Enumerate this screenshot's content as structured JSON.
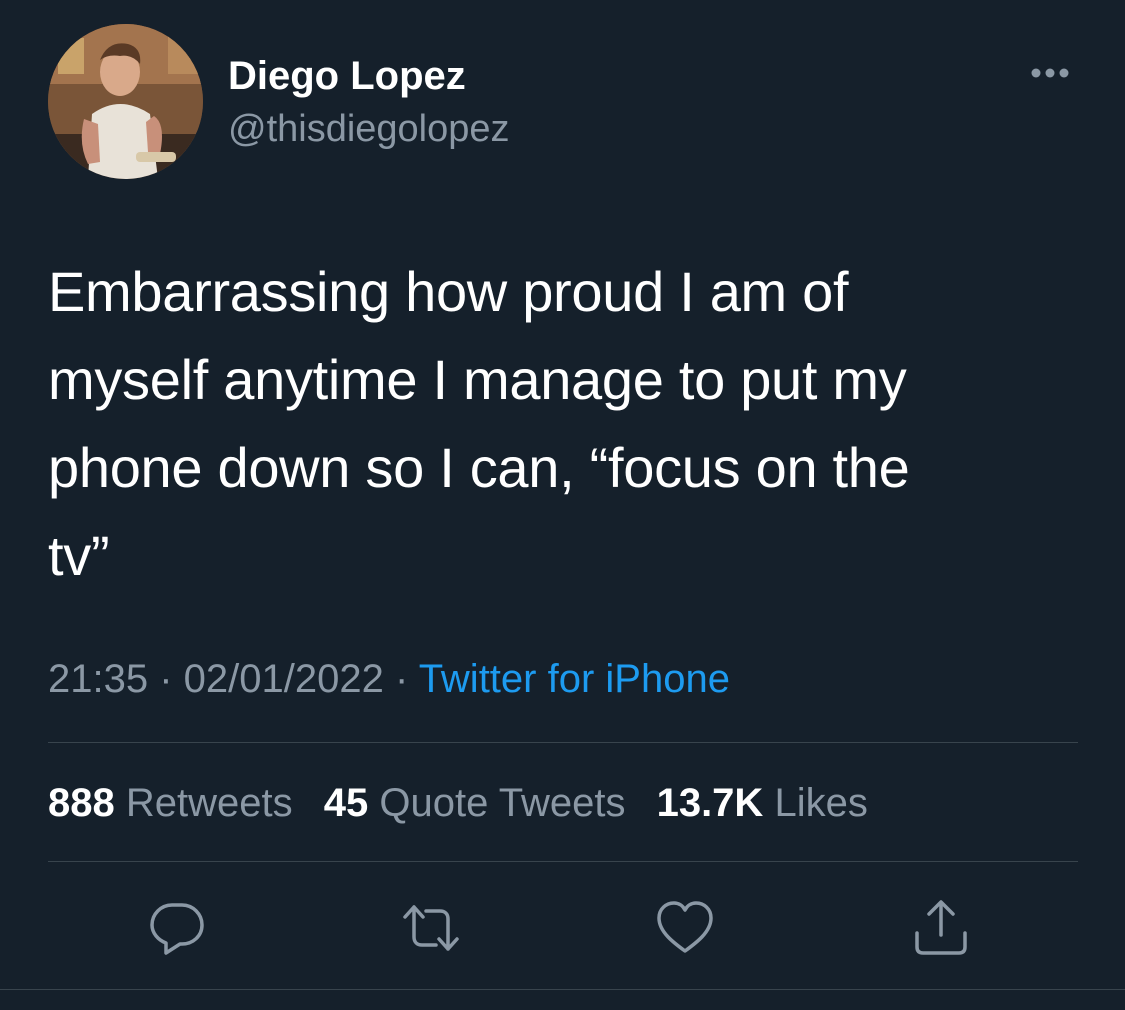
{
  "author": {
    "display_name": "Diego Lopez",
    "handle": "@thisdiegolopez"
  },
  "tweet": {
    "text": "Embarrassing how proud I am of\nmyself anytime I manage to put my\nphone down so I can, “focus on the\ntv”"
  },
  "meta": {
    "time": "21:35",
    "separator": " · ",
    "date": "02/01/2022",
    "source": "Twitter for iPhone"
  },
  "stats": {
    "retweets_count": "888",
    "retweets_label": "Retweets",
    "quotes_count": "45",
    "quotes_label": "Quote Tweets",
    "likes_count": "13.7K",
    "likes_label": "Likes"
  },
  "actions": {
    "reply_icon": "reply-icon",
    "retweet_icon": "retweet-icon",
    "like_icon": "heart-icon",
    "share_icon": "share-icon"
  },
  "colors": {
    "background": "#15202b",
    "text_primary": "#ffffff",
    "text_secondary": "#8b98a5",
    "link": "#1d9bf0",
    "divider": "#38444d"
  }
}
